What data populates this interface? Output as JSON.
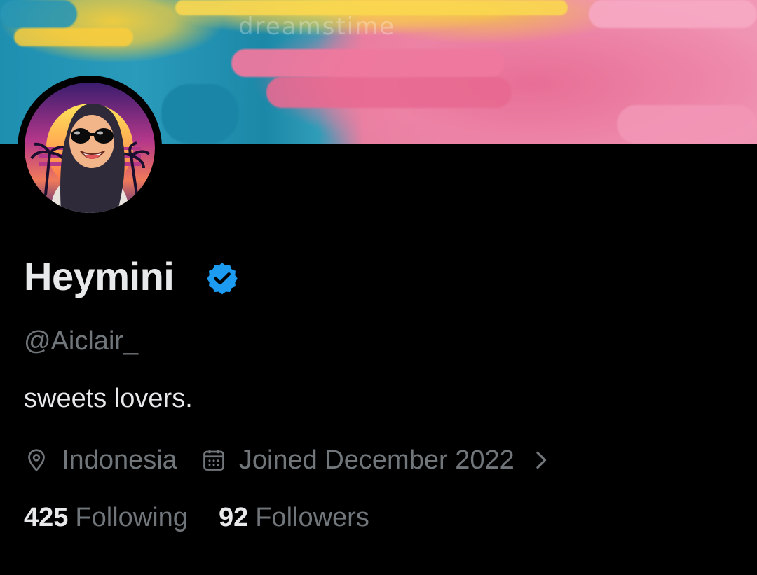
{
  "banner": {
    "watermark": "dreamstime"
  },
  "profile": {
    "display_name": "Heymini",
    "verified": true,
    "handle": "@Aiclair_",
    "bio": "sweets lovers.",
    "location": "Indonesia",
    "joined": "Joined December 2022",
    "following_count": "425",
    "following_label": "Following",
    "followers_count": "92",
    "followers_label": "Followers"
  },
  "icons": {
    "verified": "verified-badge-icon",
    "location": "location-pin-icon",
    "joined": "calendar-icon",
    "more": "chevron-right-icon"
  },
  "colors": {
    "background": "#000000",
    "primary_text": "#e7e9ea",
    "secondary_text": "#71767b",
    "verified_blue": "#1d9bf0"
  }
}
